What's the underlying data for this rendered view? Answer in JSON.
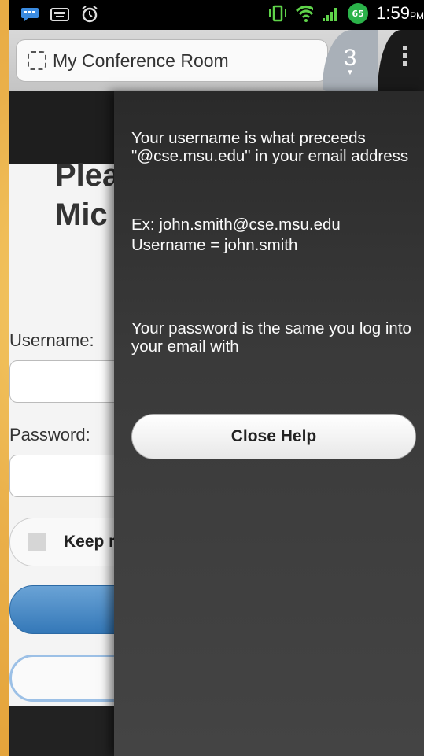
{
  "status_bar": {
    "battery_level": "65",
    "time": "1:59",
    "time_suffix": "PM",
    "icons": [
      "chat-icon",
      "keyboard-icon",
      "alarm-icon",
      "vibrate-icon",
      "wifi-icon",
      "signal-icon"
    ]
  },
  "browser": {
    "page_title": "My Conference Room",
    "tab_count": "3"
  },
  "page": {
    "heading": "Plea\nMic",
    "username_label": "Username:",
    "password_label": "Password:",
    "keep_label": "Keep r"
  },
  "help_panel": {
    "username_help": "Your username is what preceeds \"@cse.msu.edu\" in your email address",
    "example_line": "Ex: john.smith@cse.msu.edu",
    "username_example": "Username = john.smith",
    "password_help": "Your password is the same you log into your email with",
    "close_label": "Close Help"
  }
}
